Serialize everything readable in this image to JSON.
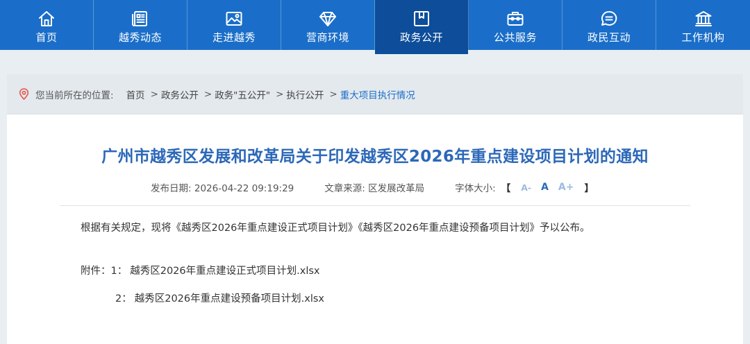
{
  "nav": {
    "items": [
      {
        "label": "首页",
        "icon": "home-icon"
      },
      {
        "label": "越秀动态",
        "icon": "news-icon"
      },
      {
        "label": "走进越秀",
        "icon": "picture-icon"
      },
      {
        "label": "营商环境",
        "icon": "diamond-icon"
      },
      {
        "label": "政务公开",
        "icon": "folder-icon",
        "active": true
      },
      {
        "label": "公共服务",
        "icon": "briefcase-icon"
      },
      {
        "label": "政民互动",
        "icon": "chat-icon"
      },
      {
        "label": "工作机构",
        "icon": "building-icon"
      }
    ]
  },
  "breadcrumb": {
    "prefix": "您当前所在的位置:",
    "items": [
      "首页",
      "政务公开",
      "政务\"五公开\"",
      "执行公开"
    ],
    "current": "重大项目执行情况",
    "separator": ">"
  },
  "article": {
    "title": "广州市越秀区发展和改革局关于印发越秀区2026年重点建设项目计划的通知",
    "publish_label": "发布日期:",
    "publish_date": "2026-04-22 09:19:29",
    "source_label": "文章来源:",
    "source": "区发展改革局",
    "font_label": "字体大小:",
    "font_open": "【",
    "font_close": "】",
    "font_small": "A-",
    "font_mid": "A",
    "font_large": "A+",
    "body": "根据有关规定，现将《越秀区2026年重点建设正式项目计划》《越秀区2026年重点建设预备项目计划》予以公布。",
    "attachments_label": "附件：",
    "attachments": [
      {
        "num": "1：",
        "name": "越秀区2026年重点建设正式项目计划.xlsx"
      },
      {
        "num": "2：",
        "name": "越秀区2026年重点建设预备项目计划.xlsx"
      }
    ]
  },
  "colors": {
    "nav_bg": "#1a6ec9",
    "nav_active": "#0d4d9a",
    "title": "#2c68b8",
    "pin": "#e8534a"
  }
}
